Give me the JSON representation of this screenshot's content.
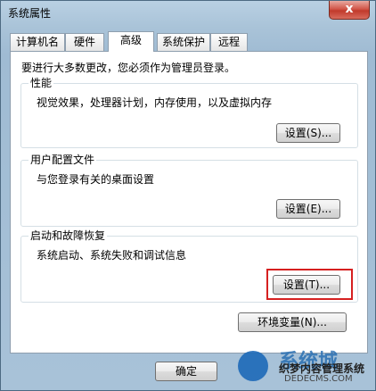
{
  "window": {
    "title": "系统属性",
    "close_label": "x"
  },
  "tabs": [
    {
      "label": "计算机名"
    },
    {
      "label": "硬件"
    },
    {
      "label": "高级"
    },
    {
      "label": "系统保护"
    },
    {
      "label": "远程"
    }
  ],
  "notice": "要进行大多数更改，您必须作为管理员登录。",
  "groups": {
    "performance": {
      "title": "性能",
      "desc": "视觉效果，处理器计划，内存使用，以及虚拟内存",
      "button": "设置(S)..."
    },
    "profiles": {
      "title": "用户配置文件",
      "desc": "与您登录有关的桌面设置",
      "button": "设置(E)..."
    },
    "startup": {
      "title": "启动和故障恢复",
      "desc": "系统启动、系统失败和调试信息",
      "button": "设置(T)..."
    }
  },
  "env_button": "环境变量(N)...",
  "footer": {
    "ok": "确定"
  },
  "watermark": {
    "line1": "系统城",
    "line2": "织梦内容管理系统",
    "line3": "DEDECMS.COM"
  },
  "colors": {
    "highlight": "#d62020",
    "watermark_blue": "#1d69b8"
  }
}
